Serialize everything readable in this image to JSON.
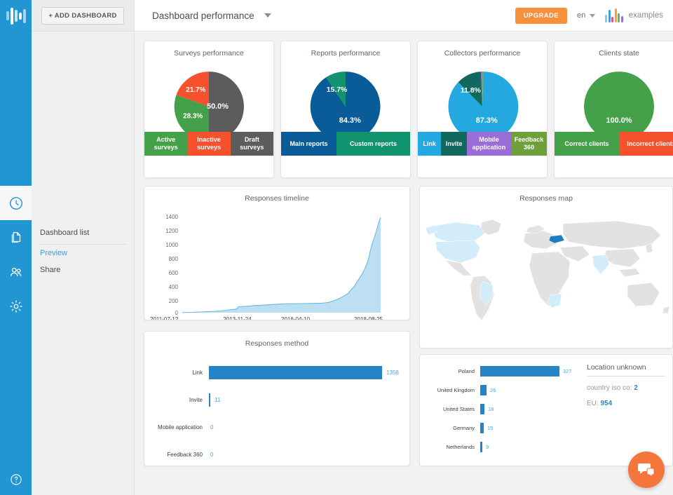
{
  "app": {
    "logo_icon": "bars-logo-icon",
    "help_icon": "question-mark-icon"
  },
  "rail": {
    "items": [
      {
        "name": "clock-icon",
        "label": "History",
        "active": true
      },
      {
        "name": "documents-icon",
        "label": "Documents",
        "active": false
      },
      {
        "name": "users-icon",
        "label": "Users",
        "active": false
      },
      {
        "name": "gear-icon",
        "label": "Settings",
        "active": false
      }
    ]
  },
  "sidebar": {
    "add_dashboard_label": "+ ADD DASHBOARD",
    "items": [
      {
        "label": "Dashboard list",
        "active": false
      },
      {
        "label": "Preview",
        "active": true
      },
      {
        "label": "Share",
        "active": false
      }
    ]
  },
  "topbar": {
    "title": "Dashboard performance",
    "dropdown_icon": "chevron-down-icon",
    "upgrade_label": "UPGRADE",
    "language": "en",
    "user_name": "examples",
    "upgrade_color": "#f7903d"
  },
  "chart_data": [
    {
      "type": "pie",
      "title": "Surveys performance",
      "categories": [
        "Active surveys",
        "Inactive surveys",
        "Draft surveys"
      ],
      "values": [
        28.3,
        21.7,
        50.0
      ],
      "labels": [
        "28.3%",
        "21.7%",
        "50.0%"
      ],
      "colors": [
        "#45a04a",
        "#f4512c",
        "#5c5c5c"
      ],
      "legend": "bottom"
    },
    {
      "type": "pie",
      "title": "Reports performance",
      "categories": [
        "Main reports",
        "Custom reports"
      ],
      "values": [
        84.3,
        15.7
      ],
      "labels": [
        "84.3%",
        "15.7%"
      ],
      "colors": [
        "#0a5c99",
        "#12936f"
      ],
      "legend": "bottom"
    },
    {
      "type": "pie",
      "title": "Collectors performance",
      "categories": [
        "Link",
        "Invite",
        "Mobile application",
        "Feedback 360"
      ],
      "values": [
        87.3,
        11.8,
        0.5,
        0.4
      ],
      "labels": [
        "87.3%",
        "11.8%",
        "",
        ""
      ],
      "colors": [
        "#24a8e0",
        "#11685c",
        "#9b6dd6",
        "#6da03a"
      ],
      "legend": "bottom"
    },
    {
      "type": "pie",
      "title": "Clients state",
      "categories": [
        "Correct clients",
        "Incorrect clients"
      ],
      "values": [
        100.0,
        0.0
      ],
      "labels": [
        "100.0%",
        ""
      ],
      "colors": [
        "#45a04a",
        "#f4512c"
      ],
      "legend": "bottom"
    },
    {
      "type": "area",
      "title": "Responses timeline",
      "xlabel": "",
      "ylabel": "",
      "ylim": [
        0,
        1400
      ],
      "yticks": [
        "0",
        "200",
        "400",
        "600",
        "800",
        "1000",
        "1200",
        "1400"
      ],
      "xticks": [
        "2011-07-12",
        "2013-11-24",
        "2016-04-10",
        "2018-08-25"
      ],
      "grid": false,
      "series_color": "#bcdff3",
      "line_color": "#6fb6de",
      "points": [
        [
          0,
          5
        ],
        [
          4,
          10
        ],
        [
          8,
          18
        ],
        [
          12,
          24
        ],
        [
          16,
          30
        ],
        [
          20,
          40
        ],
        [
          24,
          55
        ],
        [
          27,
          62
        ],
        [
          28,
          95
        ],
        [
          32,
          102
        ],
        [
          36,
          112
        ],
        [
          40,
          118
        ],
        [
          44,
          126
        ],
        [
          48,
          132
        ],
        [
          50,
          136
        ],
        [
          55,
          138
        ],
        [
          60,
          140
        ],
        [
          64,
          142
        ],
        [
          68,
          144
        ],
        [
          70,
          146
        ],
        [
          72,
          150
        ],
        [
          74,
          158
        ],
        [
          76,
          172
        ],
        [
          78,
          196
        ],
        [
          80,
          222
        ],
        [
          82,
          252
        ],
        [
          84,
          288
        ],
        [
          85,
          330
        ],
        [
          86,
          360
        ],
        [
          87,
          392
        ],
        [
          88,
          430
        ],
        [
          89,
          476
        ],
        [
          90,
          520
        ],
        [
          91,
          570
        ],
        [
          92,
          628
        ],
        [
          93,
          700
        ],
        [
          94,
          790
        ],
        [
          95,
          880
        ],
        [
          96,
          1000
        ],
        [
          97,
          1080
        ],
        [
          98,
          1180
        ],
        [
          99,
          1290
        ],
        [
          100,
          1370
        ]
      ]
    },
    {
      "type": "map",
      "title": "Responses map",
      "highlight_primary": "Poland",
      "primary_color": "#1a7ec0",
      "secondary_color": "#d2ecfa",
      "base_color": "#e2e2e2"
    },
    {
      "type": "bar",
      "title": "Responses method",
      "orientation": "horizontal",
      "categories": [
        "Link",
        "Invite",
        "Mobile application",
        "Feedback 360"
      ],
      "values": [
        1358,
        11,
        0,
        0
      ],
      "value_labels": [
        "1358",
        "11",
        "0",
        "0"
      ],
      "bar_color": "#2484c6",
      "max": 1358
    },
    {
      "type": "bar",
      "title": "",
      "orientation": "horizontal",
      "categories": [
        "Poland",
        "United Kingdom",
        "United States",
        "Germany",
        "Netherlands"
      ],
      "values": [
        327,
        26,
        18,
        15,
        9
      ],
      "value_labels": [
        "327",
        "26",
        "18",
        "15",
        "9"
      ],
      "bar_color": "#2484c6",
      "max": 327
    }
  ],
  "location_panel": {
    "title": "Location unknown",
    "stats": [
      {
        "label": "country iso co:",
        "value": "2"
      },
      {
        "label": "EU:",
        "value": "954"
      }
    ]
  },
  "chat": {
    "icon": "chat-bubbles-icon"
  }
}
